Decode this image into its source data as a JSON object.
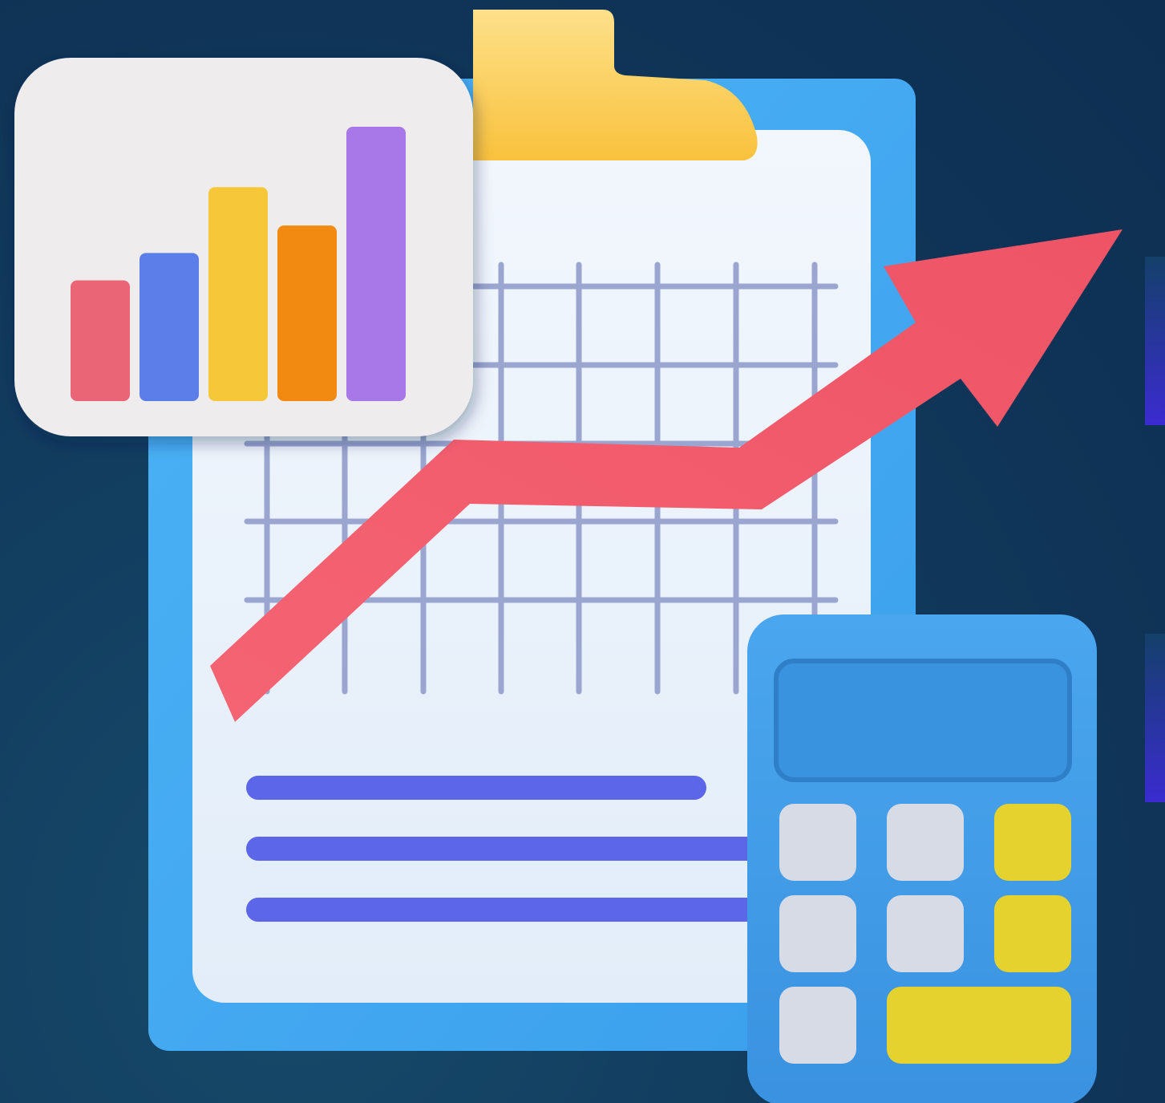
{
  "scene": {
    "colors": {
      "background": "#103658",
      "clipboard_board": "#3fa6f0",
      "clipboard_clip": "#fbc94a",
      "paper": "#e6f0fb",
      "grid_lines": "#9aa6cf",
      "text_lines": "#5b66e8",
      "trend_arrow": "#f25a6a",
      "card": "#efecee",
      "calculator_body": "#3f9ae6",
      "calculator_screen": "#3a93df",
      "key_gray": "#d7dbe6",
      "key_yellow": "#e5d22e",
      "side_accent": "#3b2bd0"
    },
    "bar_card": {
      "bar_levels": [
        0.44,
        0.54,
        0.78,
        0.64,
        1.0
      ],
      "bar_colors": [
        "#ea6677",
        "#5b7ee8",
        "#f7c73a",
        "#f28a12",
        "#a877e8"
      ]
    },
    "document": {
      "text_line_count": 3
    },
    "calculator": {
      "key_rows": [
        [
          "gray",
          "gray",
          "yellow"
        ],
        [
          "gray",
          "gray",
          "yellow"
        ],
        [
          "gray",
          "yellow-wide"
        ]
      ]
    },
    "icons": [
      "clipboard-icon",
      "bar-chart-icon",
      "trend-arrow-icon",
      "calculator-icon"
    ]
  }
}
